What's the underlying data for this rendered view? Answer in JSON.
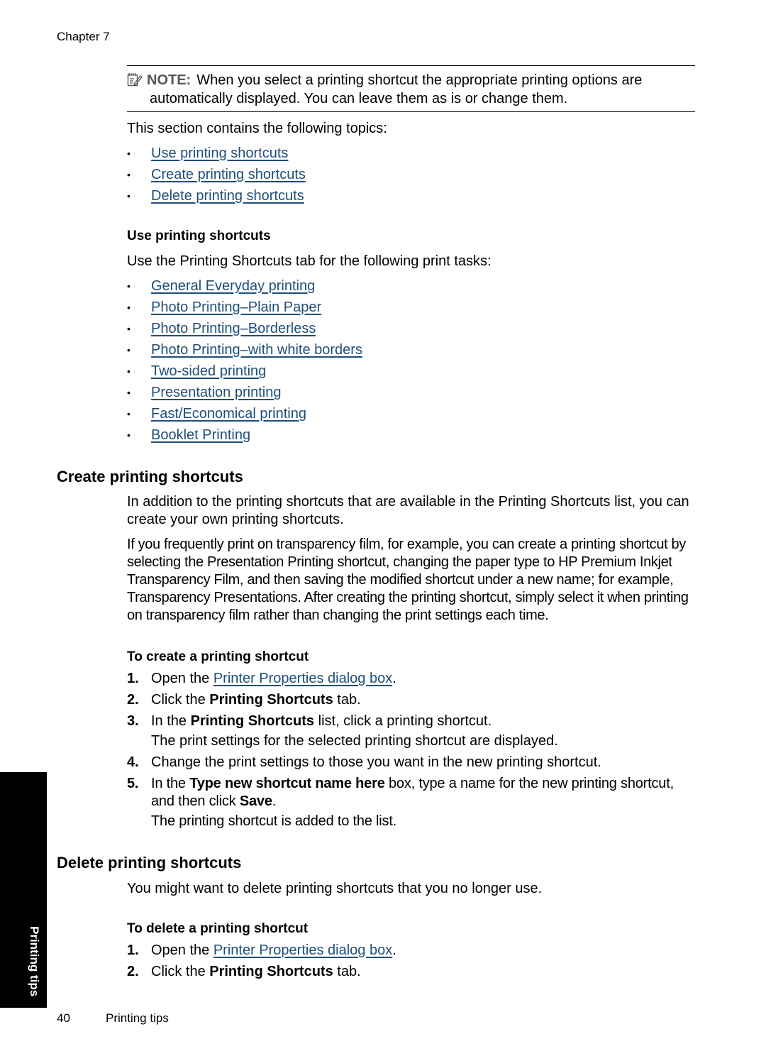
{
  "header": {
    "chapter": "Chapter 7"
  },
  "note": {
    "icon": "note-pencil-icon",
    "label": "NOTE:",
    "line1": "When you select a printing shortcut the appropriate printing options are",
    "line2": "automatically displayed. You can leave them as is or change them."
  },
  "intro": {
    "text": "This section contains the following topics:",
    "topics": [
      "Use printing shortcuts",
      "Create printing shortcuts",
      "Delete printing shortcuts"
    ]
  },
  "use_section": {
    "heading": "Use printing shortcuts",
    "text": "Use the Printing Shortcuts tab for the following print tasks:",
    "tasks": [
      "General Everyday printing",
      "Photo Printing–Plain Paper",
      "Photo Printing–Borderless",
      "Photo Printing–with white borders",
      "Two-sided printing",
      "Presentation printing",
      "Fast/Economical printing",
      "Booklet Printing"
    ]
  },
  "create_section": {
    "heading": "Create printing shortcuts",
    "para1": "In addition to the printing shortcuts that are available in the Printing Shortcuts list, you can create your own printing shortcuts.",
    "para2": "If you frequently print on transparency film, for example, you can create a printing shortcut by selecting the Presentation Printing shortcut, changing the paper type to HP Premium Inkjet Transparency Film, and then saving the modified shortcut under a new name; for example, Transparency Presentations. After creating the printing shortcut, simply select it when printing on transparency film rather than changing the print settings each time.",
    "procedure_title": "To create a printing shortcut",
    "steps": {
      "s1": {
        "num": "1.",
        "pre": "Open the ",
        "link": "Printer Properties dialog box",
        "post": "."
      },
      "s2": {
        "num": "2.",
        "pre": "Click the ",
        "bold": "Printing Shortcuts",
        "post": " tab."
      },
      "s3": {
        "num": "3.",
        "pre": "In the ",
        "bold": "Printing Shortcuts",
        "post": " list, click a printing shortcut.",
        "sub": "The print settings for the selected printing shortcut are displayed."
      },
      "s4": {
        "num": "4.",
        "text": "Change the print settings to those you want in the new printing shortcut."
      },
      "s5": {
        "num": "5.",
        "pre": "In the ",
        "bold": "Type new shortcut name here",
        "mid": " box, type a name for the new printing shortcut, and then click ",
        "bold2": "Save",
        "post": ".",
        "sub": "The printing shortcut is added to the list."
      }
    }
  },
  "delete_section": {
    "heading": "Delete printing shortcuts",
    "text": "You might want to delete printing shortcuts that you no longer use.",
    "procedure_title": "To delete a printing shortcut",
    "steps": {
      "s1": {
        "num": "1.",
        "pre": "Open the ",
        "link": "Printer Properties dialog box",
        "post": "."
      },
      "s2": {
        "num": "2.",
        "pre": "Click the ",
        "bold": "Printing Shortcuts",
        "post": " tab."
      }
    }
  },
  "side_tab": {
    "label": "Printing tips"
  },
  "footer": {
    "page_number": "40",
    "section_title": "Printing tips"
  }
}
